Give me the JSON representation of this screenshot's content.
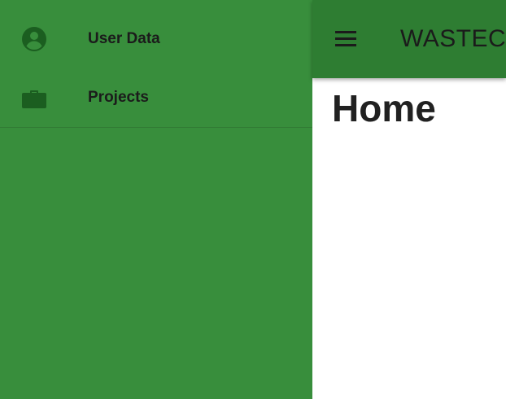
{
  "drawer": {
    "items": [
      {
        "label": "User Data",
        "icon": "account-circle-icon"
      },
      {
        "label": "Projects",
        "icon": "briefcase-icon"
      }
    ]
  },
  "appbar": {
    "title": "WASTECO",
    "menu_icon": "menu-icon"
  },
  "main": {
    "title": "Home"
  },
  "colors": {
    "drawer_bg": "#388e3c",
    "appbar_bg": "#2e7d32",
    "icon": "#1b5e20"
  }
}
